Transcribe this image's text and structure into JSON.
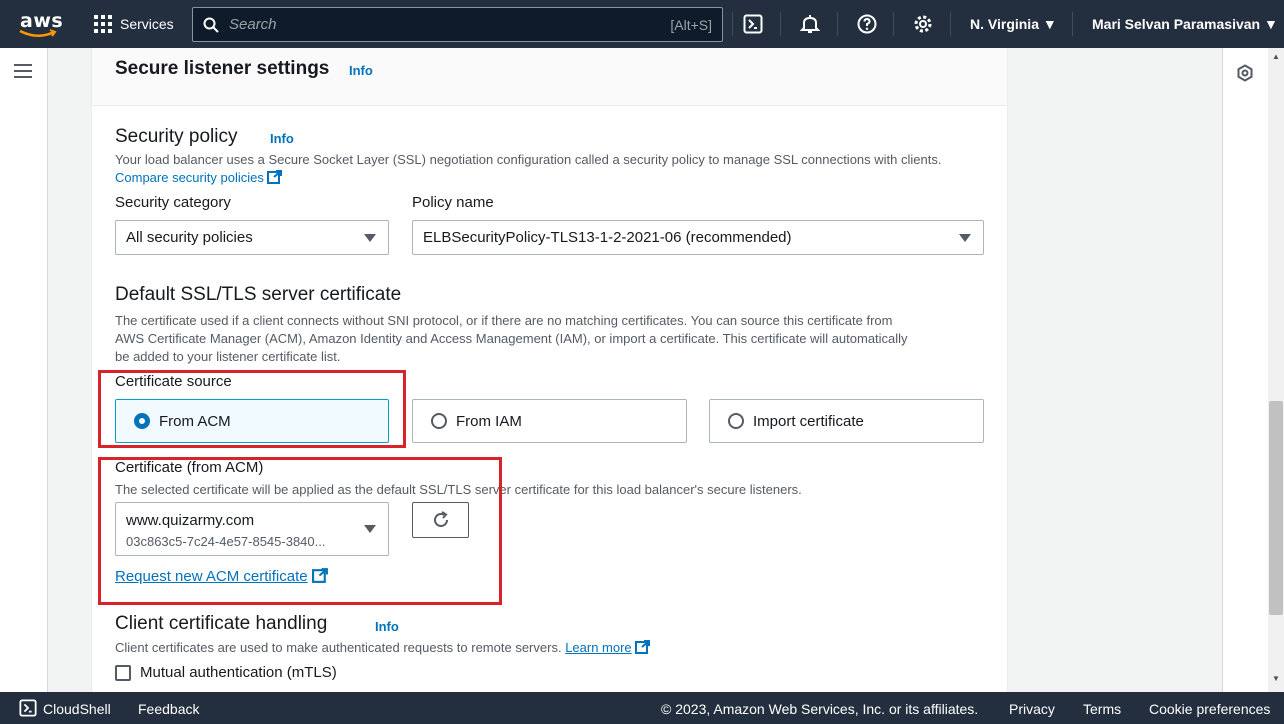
{
  "topnav": {
    "logo_text": "aws",
    "services_label": "Services",
    "search_placeholder": "Search",
    "search_shortcut": "[Alt+S]",
    "region": "N. Virginia ▼",
    "user": "Mari Selvan Paramasivan ▼"
  },
  "panel": {
    "title": "Secure listener settings",
    "title_info": "Info"
  },
  "security_policy": {
    "heading": "Security policy",
    "info": "Info",
    "description": "Your load balancer uses a Secure Socket Layer (SSL) negotiation configuration called a security policy to manage SSL connections with clients.",
    "compare_link": "Compare security policies",
    "category_label": "Security category",
    "category_value": "All security policies",
    "policy_label": "Policy name",
    "policy_value": "ELBSecurityPolicy-TLS13-1-2-2021-06 (recommended)"
  },
  "certificate": {
    "heading": "Default SSL/TLS server certificate",
    "description_line1": "The certificate used if a client connects without SNI protocol, or if there are no matching certificates. You can source this certificate from",
    "description_line2": "AWS Certificate Manager (ACM), Amazon Identity and Access Management (IAM), or import a certificate. This certificate will automatically",
    "description_line3": "be added to your listener certificate list.",
    "source_label": "Certificate source",
    "sources": [
      "From ACM",
      "From IAM",
      "Import certificate"
    ],
    "selected_source": "From ACM",
    "acm_label": "Certificate (from ACM)",
    "acm_description": "The selected certificate will be applied as the default SSL/TLS server certificate for this load balancer's secure listeners.",
    "acm_domain": "www.quizarmy.com",
    "acm_id": "03c863c5-7c24-4e57-8545-3840...",
    "request_link": "Request new ACM certificate"
  },
  "client_cert": {
    "heading": "Client certificate handling",
    "info": "Info",
    "description": "Client certificates are used to make authenticated requests to remote servers.",
    "learn_more": "Learn more",
    "mtls_label": "Mutual authentication (mTLS)"
  },
  "footer": {
    "cloudshell": "CloudShell",
    "feedback": "Feedback",
    "copyright": "© 2023, Amazon Web Services, Inc. or its affiliates.",
    "privacy": "Privacy",
    "terms": "Terms",
    "cookie": "Cookie preferences"
  },
  "colors": {
    "nav_bg": "#232f3e",
    "link": "#0073bb",
    "highlight": "#d9222a",
    "selected_tile_bg": "#f1faff"
  }
}
